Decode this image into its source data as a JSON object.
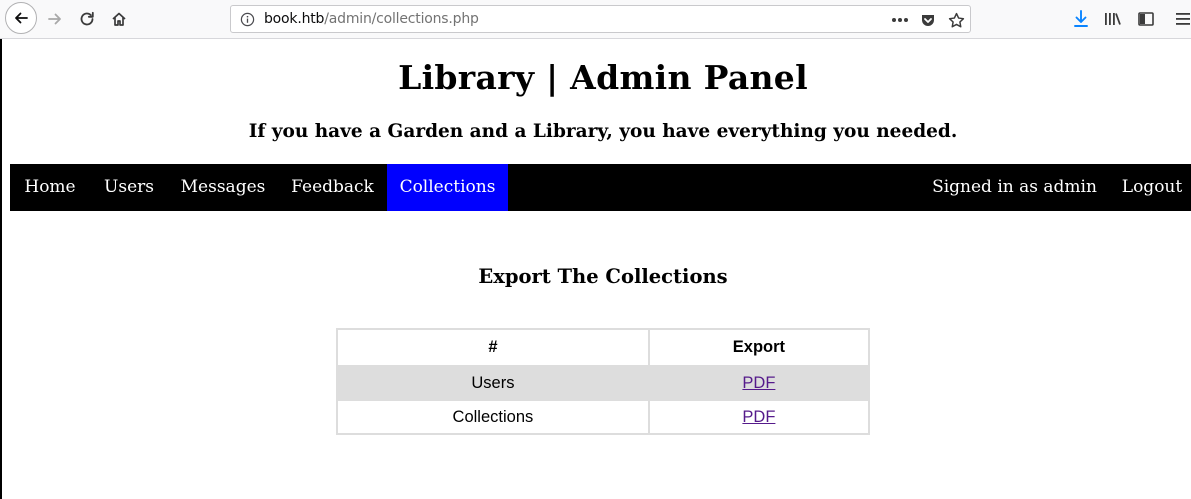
{
  "browser": {
    "url_host": "book.htb",
    "url_path": "/admin/collections.php",
    "icons": {
      "back": "back-arrow-icon",
      "forward": "forward-arrow-icon",
      "reload": "reload-icon",
      "home": "home-icon",
      "info": "info-icon",
      "more": "more-actions-icon",
      "pocket": "pocket-icon",
      "star": "bookmark-star-icon",
      "download": "download-icon",
      "library": "library-icon",
      "sidebar": "sidebar-icon",
      "menu": "hamburger-menu-icon"
    },
    "download_color": "#0a84ff"
  },
  "site": {
    "title": "Library | Admin Panel",
    "tagline": "If you have a Garden and a Library, you have everything you needed."
  },
  "nav": {
    "items": [
      {
        "label": "Home"
      },
      {
        "label": "Users"
      },
      {
        "label": "Messages"
      },
      {
        "label": "Feedback"
      },
      {
        "label": "Collections",
        "active": true
      }
    ],
    "right": {
      "signed_in": "Signed in as admin",
      "logout": "Logout"
    },
    "active_color": "#0000ff",
    "bar_color": "#000000"
  },
  "main": {
    "heading": "Export The Collections",
    "table": {
      "headers": [
        "#",
        "Export"
      ],
      "rows": [
        {
          "name": "Users",
          "export": "PDF"
        },
        {
          "name": "Collections",
          "export": "PDF"
        }
      ]
    }
  }
}
